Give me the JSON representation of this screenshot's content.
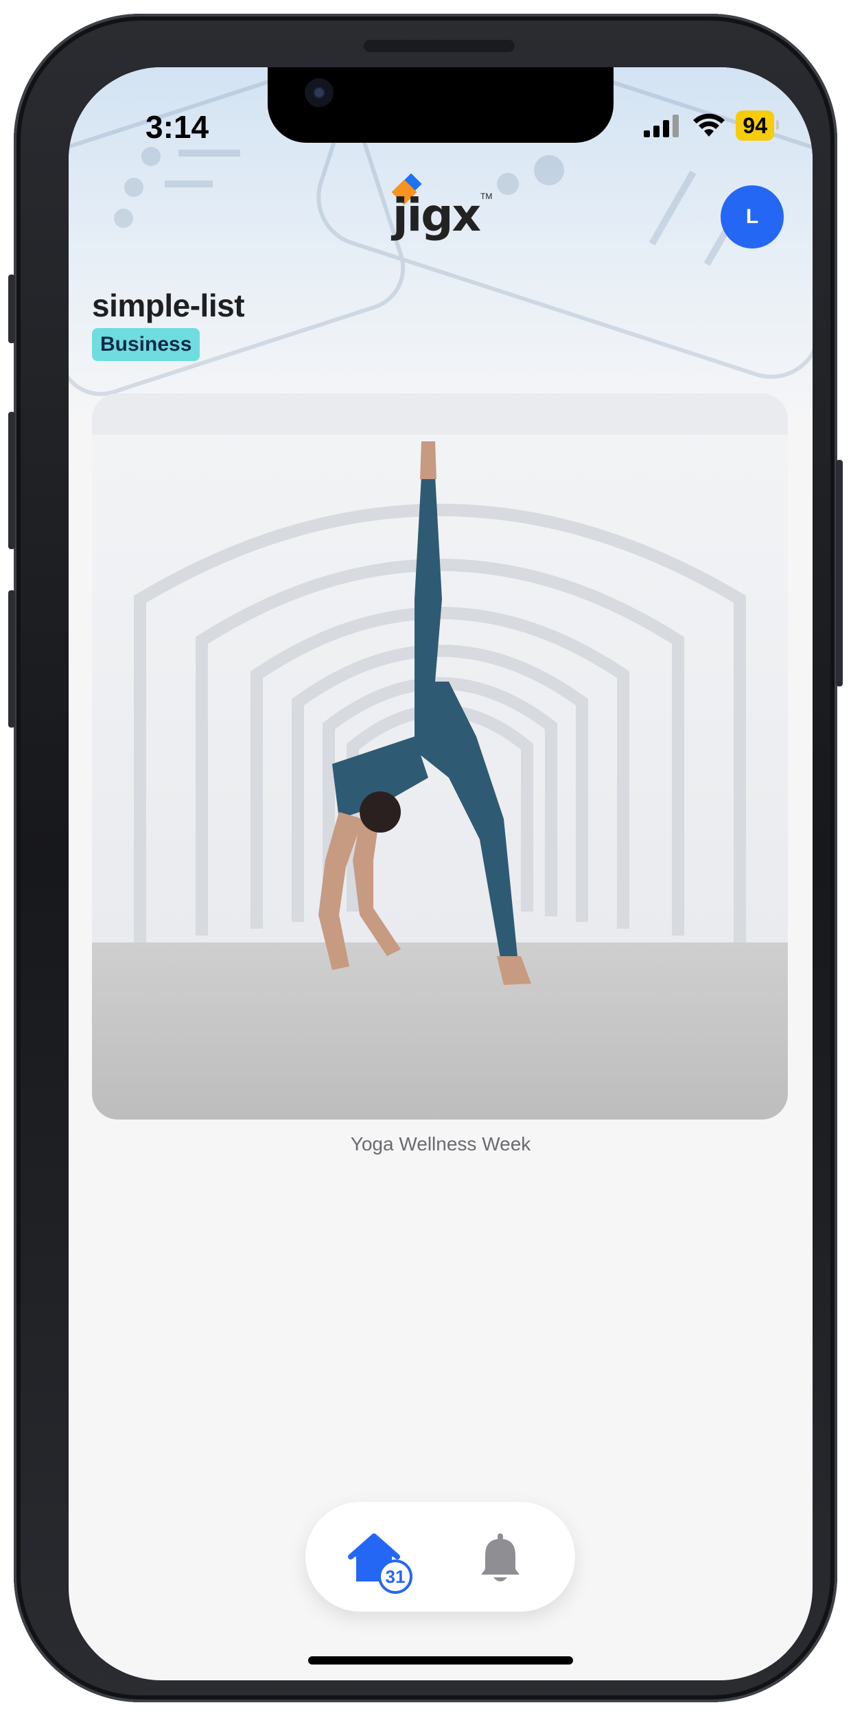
{
  "status_bar": {
    "time": "3:14",
    "battery_level": "94"
  },
  "header": {
    "logo_text": "jigx",
    "logo_trademark": "TM",
    "avatar_initial": "L"
  },
  "page": {
    "title": "simple-list",
    "badge": "Business"
  },
  "content": {
    "image_caption": "Yoga Wellness Week"
  },
  "tabbar": {
    "home_badge_count": "31"
  },
  "colors": {
    "accent": "#2567f5",
    "badge_bg": "#6fdcdf",
    "battery": "#f6cc0b"
  },
  "icons": {
    "home": "home-icon",
    "notifications": "bell-icon",
    "signal": "cellular-signal-icon",
    "wifi": "wifi-icon",
    "battery": "battery-icon"
  }
}
